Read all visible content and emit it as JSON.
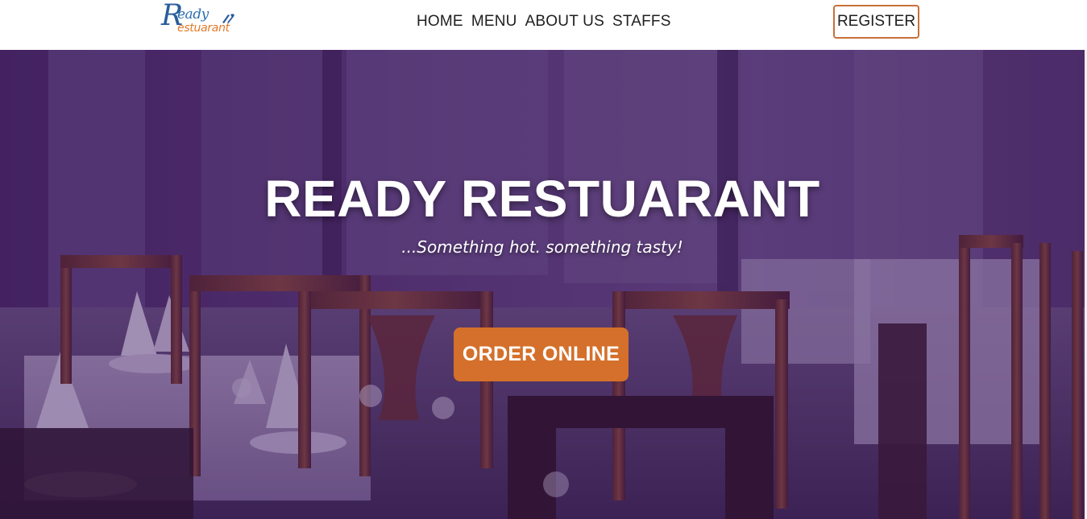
{
  "navbar": {
    "logo": {
      "line1": "eady",
      "initial": "R",
      "line2": "estuarant",
      "alt": "Ready Restuarant logo"
    },
    "links": [
      {
        "label": "HOME"
      },
      {
        "label": "MENU"
      },
      {
        "label": "ABOUT US"
      },
      {
        "label": "STAFFS"
      }
    ],
    "register_label": "REGISTER"
  },
  "hero": {
    "title": "READY RESTUARANT",
    "tagline": "...Something hot. something tasty!",
    "cta_label": "ORDER ONLINE",
    "background": "restaurant-dining-room-photo"
  },
  "colors": {
    "accent": "#d4702b",
    "register_border": "#c8703a",
    "logo_blue": "#2a6fb0",
    "logo_orange": "#e07a2a",
    "overlay": "#3a145a"
  }
}
